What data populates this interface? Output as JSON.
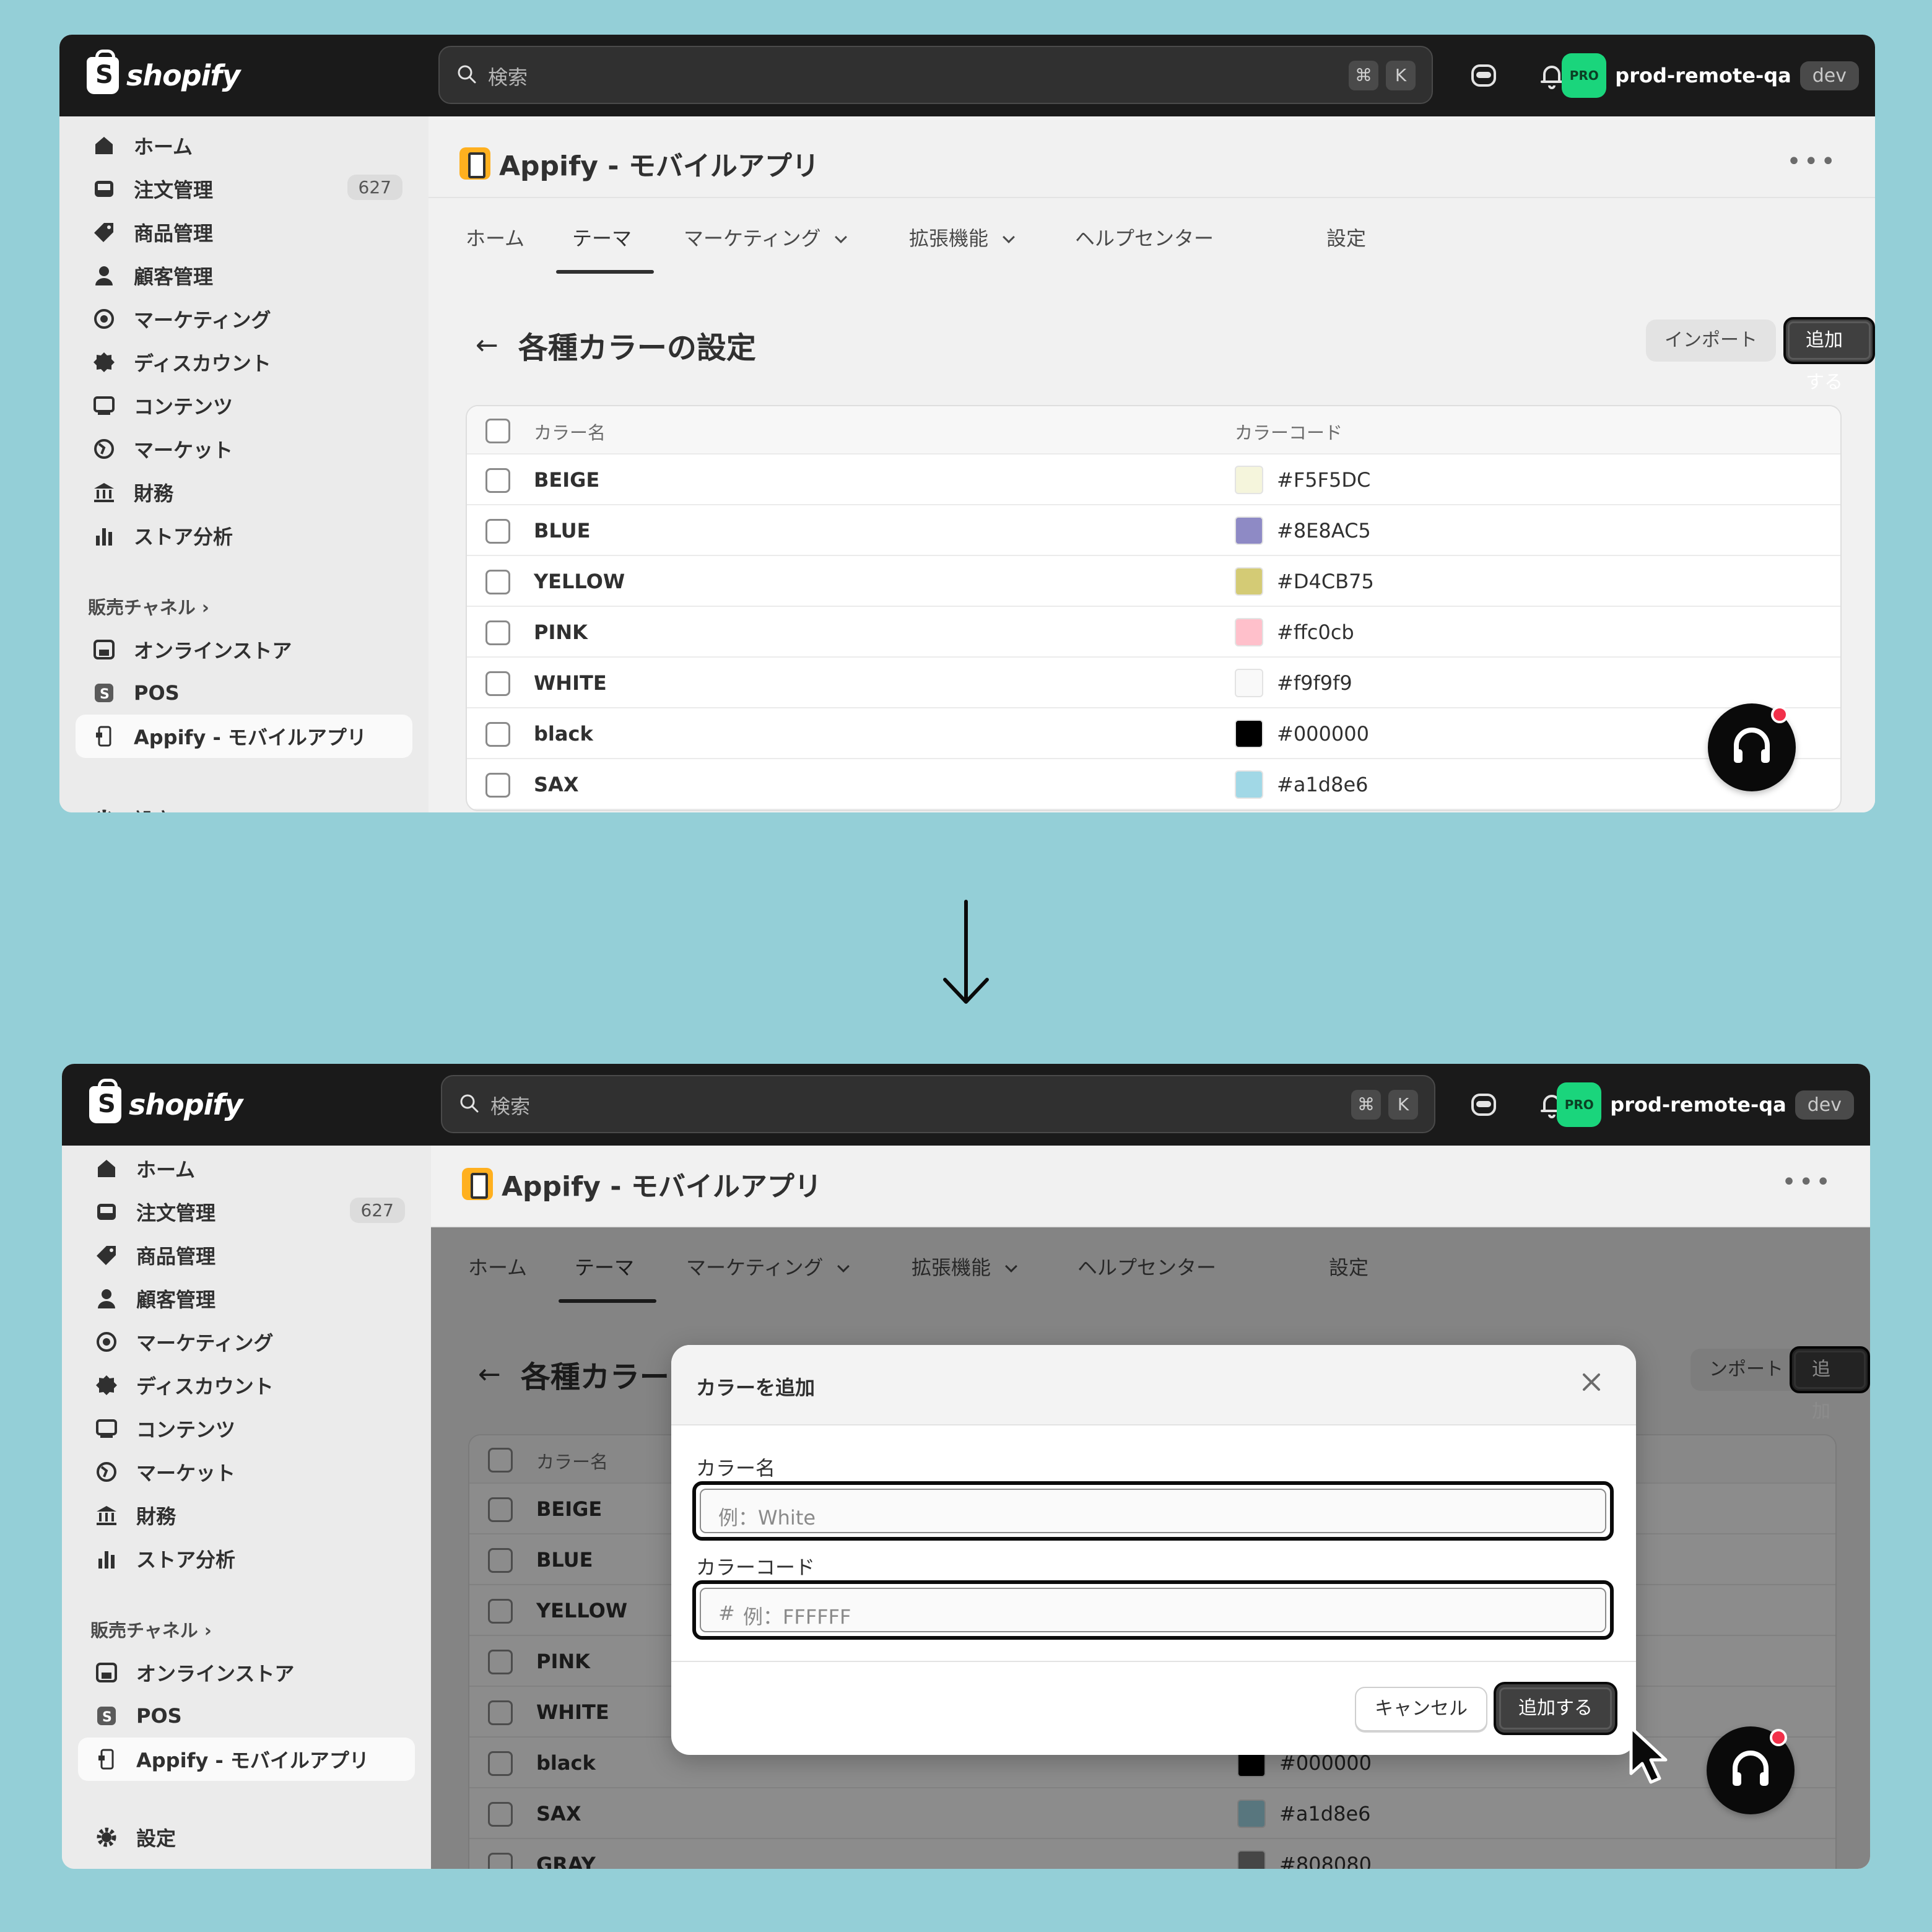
{
  "topbar": {
    "brand": "shopify",
    "search_placeholder": "検索",
    "shortcut_cmd": "⌘",
    "shortcut_key": "K",
    "pro_badge": "PRO",
    "store_name": "prod-remote-qa",
    "env_badge": "dev"
  },
  "sidebar": {
    "items": [
      {
        "label": "ホーム",
        "icon": "home-icon"
      },
      {
        "label": "注文管理",
        "icon": "inbox-icon",
        "count": "627"
      },
      {
        "label": "商品管理",
        "icon": "tag-icon"
      },
      {
        "label": "顧客管理",
        "icon": "person-icon"
      },
      {
        "label": "マーケティング",
        "icon": "target-icon"
      },
      {
        "label": "ディスカウント",
        "icon": "discount-icon"
      },
      {
        "label": "コンテンツ",
        "icon": "content-icon"
      },
      {
        "label": "マーケット",
        "icon": "globe-icon"
      },
      {
        "label": "財務",
        "icon": "bank-icon"
      },
      {
        "label": "ストア分析",
        "icon": "bar-chart-icon"
      }
    ],
    "sales_channels_heading": "販売チャネル",
    "channels": [
      {
        "label": "オンラインストア",
        "icon": "store-icon"
      },
      {
        "label": "POS",
        "icon": "pos-icon"
      },
      {
        "label": "Appify - モバイルアプリ",
        "icon": "mobile-app-icon"
      }
    ],
    "settings_label": "設定",
    "settings_label_cropped": "設定"
  },
  "app": {
    "title": "Appify - モバイルアプリ",
    "more": "•••",
    "tabs": [
      "ホーム",
      "テーマ",
      "マーケティング",
      "拡張機能",
      "ヘルプセンター",
      "設定"
    ]
  },
  "page": {
    "back": "←",
    "title": "各種カラーの設定",
    "title_partial": "各種カラー",
    "import_button": "インポート",
    "import_button_partial": "ンポート",
    "add_button": "追加する"
  },
  "table": {
    "columns": [
      "カラー名",
      "カラーコード"
    ],
    "rows": [
      {
        "name": "BEIGE",
        "code": "#F5F5DC",
        "swatch": "#F5F5DC"
      },
      {
        "name": "BLUE",
        "code": "#8E8AC5",
        "swatch": "#8E8AC5"
      },
      {
        "name": "YELLOW",
        "code": "#D4CB75",
        "swatch": "#D4CB75"
      },
      {
        "name": "PINK",
        "code": "#ffc0cb",
        "swatch": "#ffc0cb"
      },
      {
        "name": "WHITE",
        "code": "#f9f9f9",
        "swatch": "#f9f9f9"
      },
      {
        "name": "black",
        "code": "#000000",
        "swatch": "#000000"
      },
      {
        "name": "SAX",
        "code": "#a1d8e6",
        "swatch": "#a1d8e6"
      },
      {
        "name": "GRAY",
        "code": "#808080",
        "swatch": "#808080"
      }
    ]
  },
  "modal": {
    "title": "カラーを追加",
    "name_label": "カラー名",
    "name_placeholder": "例：White",
    "code_label": "カラーコード",
    "code_prefix": "#",
    "code_placeholder": "例：FFFFFF",
    "cancel_button": "キャンセル",
    "add_button": "追加する"
  },
  "colors": {
    "background": "#94cfd7",
    "topbar": "#1a1a1a",
    "pro_badge": "#1ad57c",
    "notification_dot": "#f2304a",
    "app_icon": "#ffb01f"
  }
}
